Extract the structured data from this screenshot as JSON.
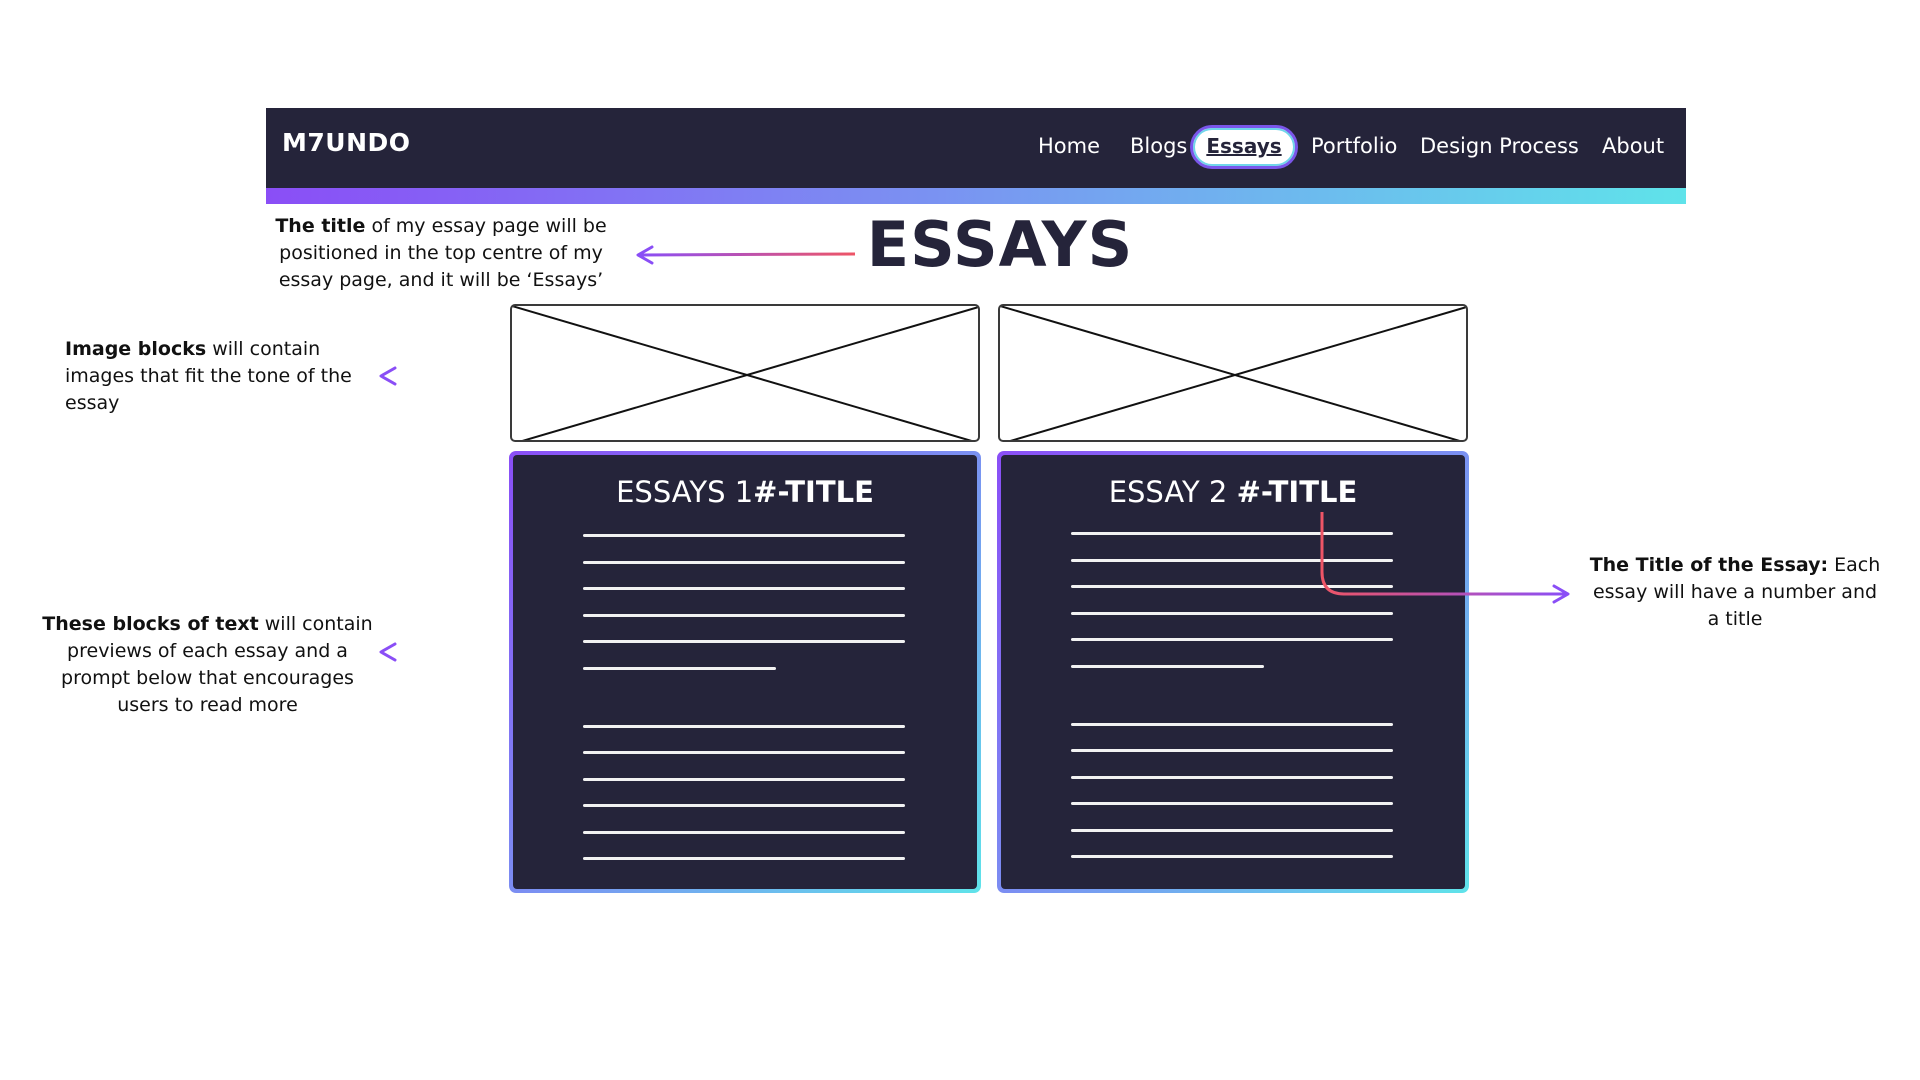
{
  "nav": {
    "brand": "M7UNDO",
    "items": [
      {
        "label": "Home"
      },
      {
        "label": "Blogs"
      },
      {
        "label": "Essays"
      },
      {
        "label": "Portfolio"
      },
      {
        "label": "Design Process"
      },
      {
        "label": "About"
      }
    ],
    "active_item": "Essays"
  },
  "page": {
    "title": "ESSAYS"
  },
  "cards": [
    {
      "title_prefix": "ESSAYS 1",
      "title_bold": "#-TITLE"
    },
    {
      "title_prefix": "ESSAY 2 ",
      "title_bold": "#-TITLE"
    }
  ],
  "annotations": {
    "title_note": {
      "bold": "The title",
      "rest_line1": " of my essay page will be",
      "line2": "positioned in the top centre of my",
      "line3": "essay page, and it will be ‘Essays’"
    },
    "image_note": {
      "bold": "Image blocks",
      "rest_line1": " will contain",
      "line2": "images that fit the tone of the",
      "line3": "essay"
    },
    "text_note": {
      "bold": "These blocks of text",
      "rest_line1": " will contain",
      "line2": "previews of each essay and a",
      "line3": "prompt below that encourages",
      "line4": "users to read more"
    },
    "essay_title_note": {
      "bold": "The Title of the Essay:",
      "rest_line1": " Each",
      "line2": "essay will have a number and",
      "line3": "a title"
    }
  },
  "colors": {
    "navbar_bg": "#25243a",
    "gradient_start": "#8a4ef6",
    "gradient_end": "#5fe3ea",
    "card_bg": "#25243a",
    "arrow_red": "#ee5566",
    "arrow_purple": "#8a4ef6"
  }
}
